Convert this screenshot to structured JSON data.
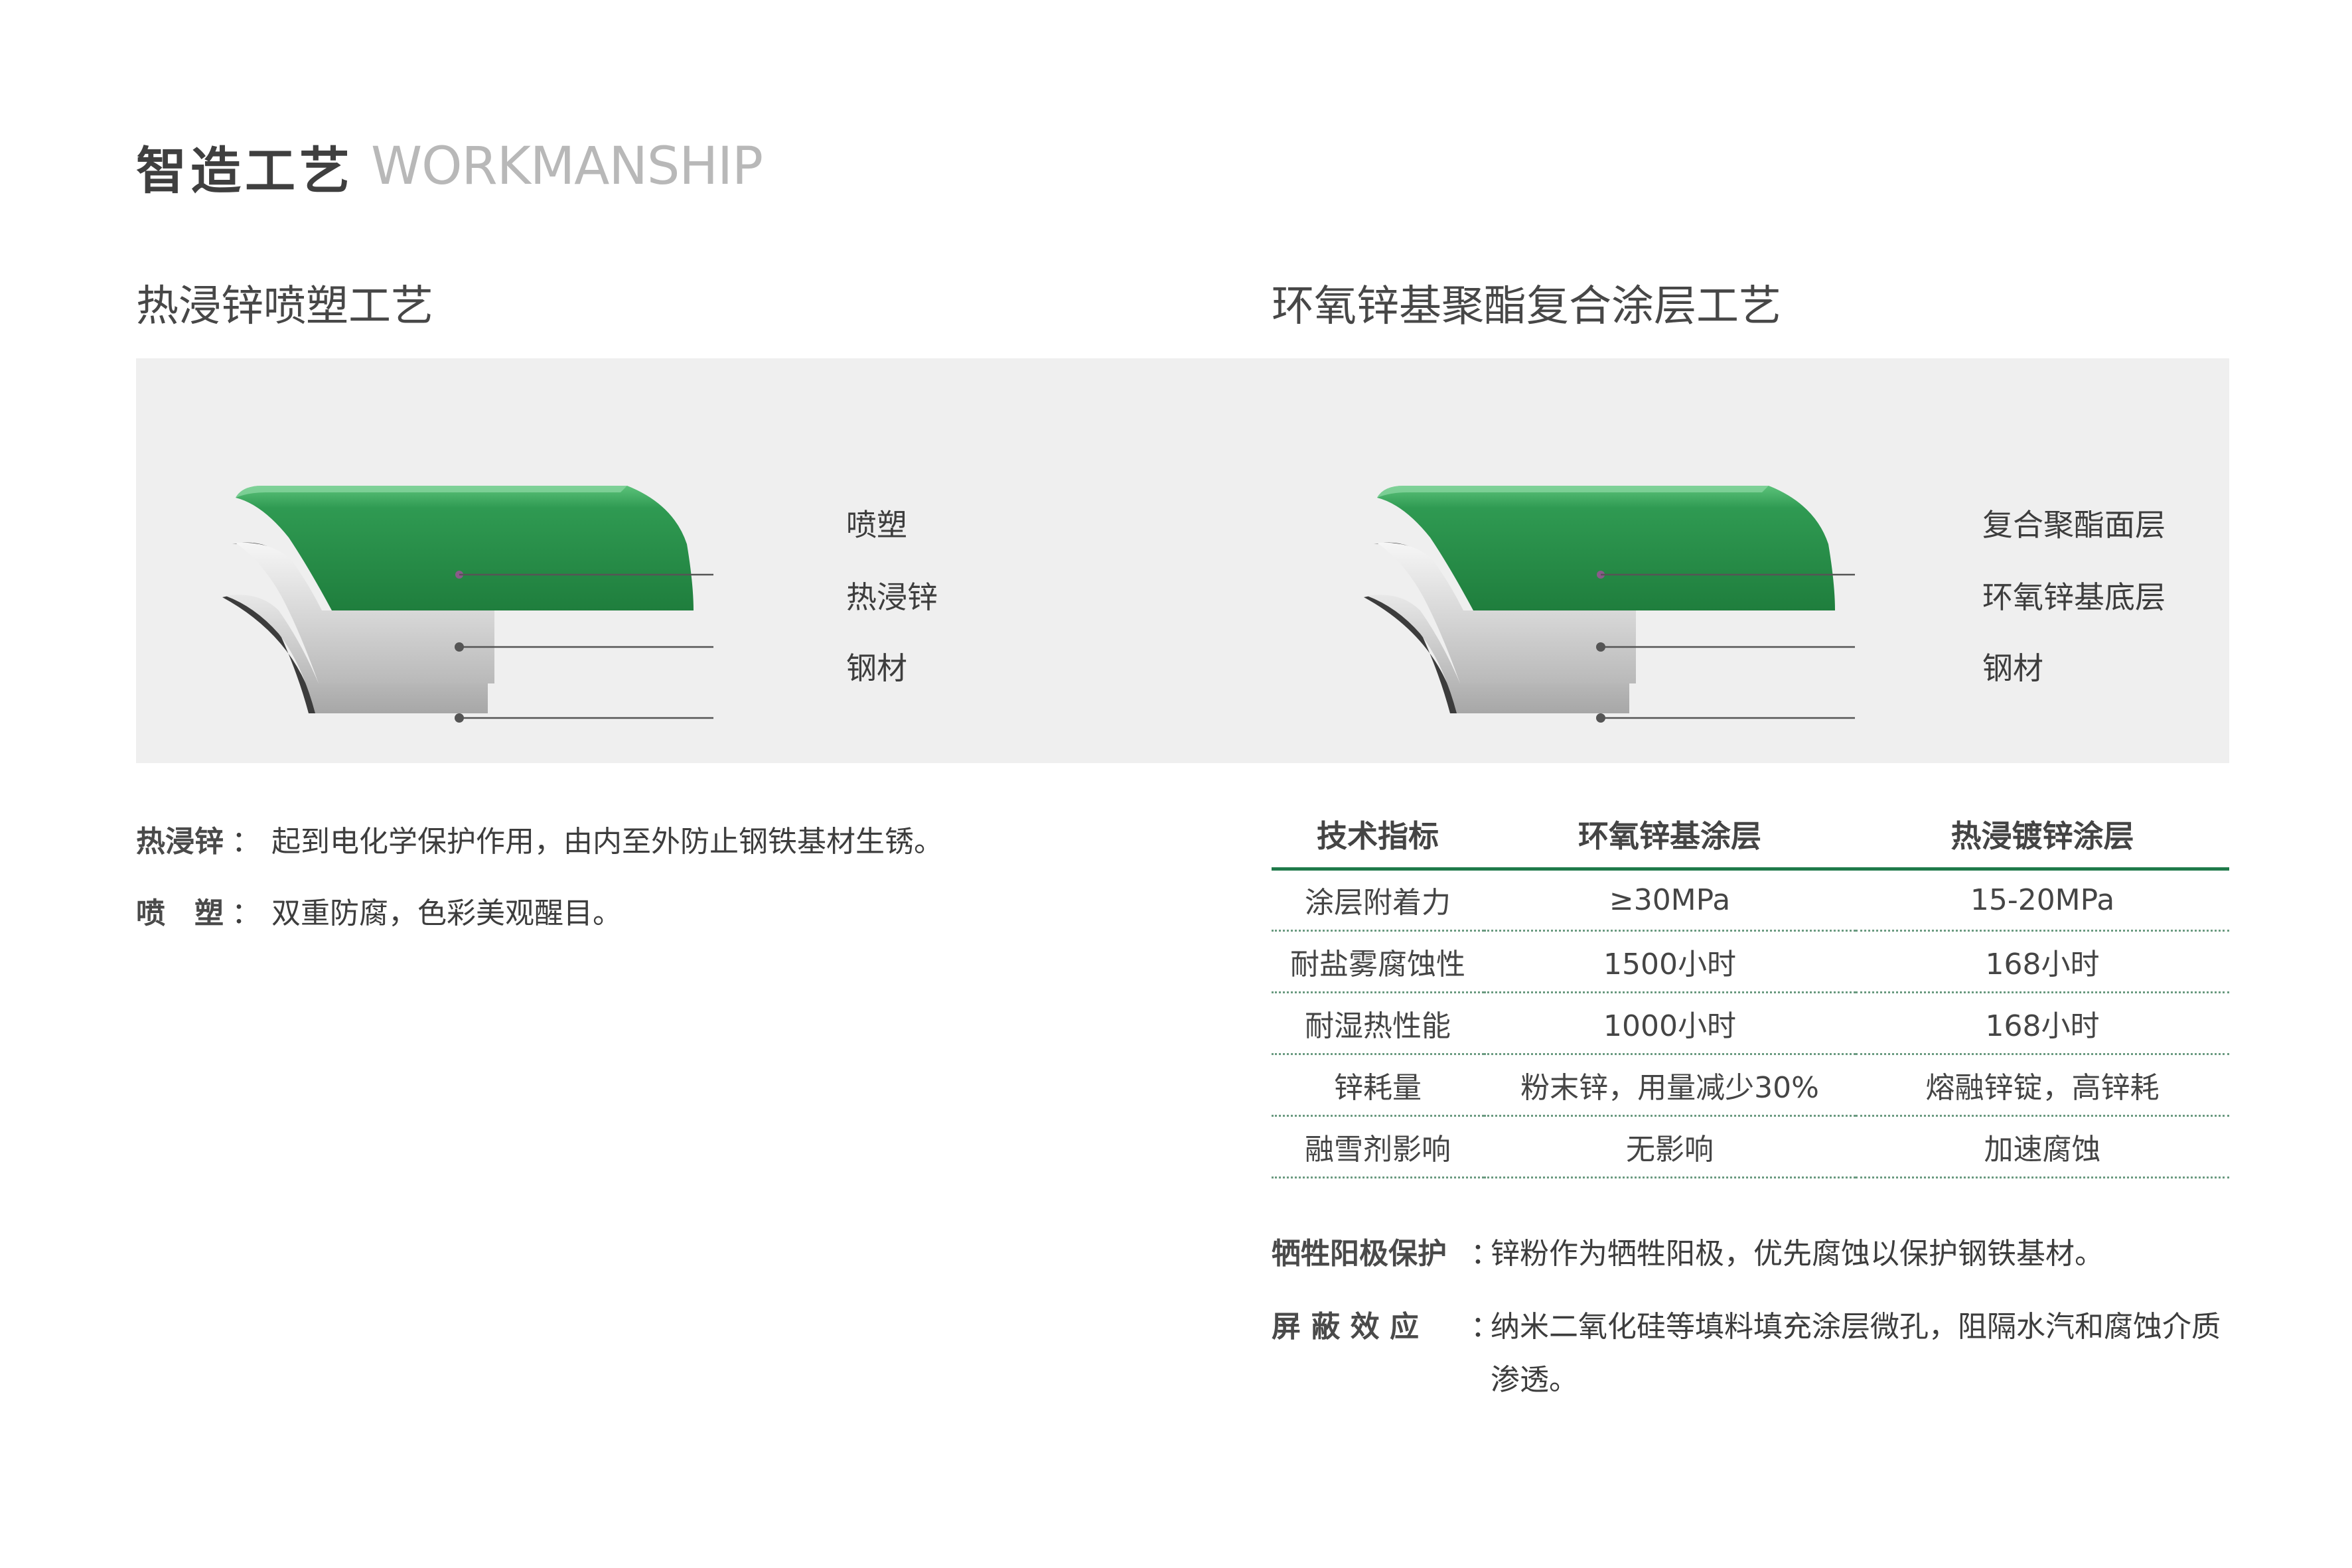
{
  "header": {
    "title_cn": "智造工艺",
    "title_en": "WORKMANSHIP"
  },
  "sections": {
    "left_title": "热浸锌喷塑工艺",
    "right_title": "环氧锌基聚酯复合涂层工艺"
  },
  "illustrations": {
    "left": {
      "labels": [
        "喷塑",
        "热浸锌",
        "钢材"
      ]
    },
    "right": {
      "labels": [
        "复合聚酯面层",
        "环氧锌基底层",
        "钢材"
      ]
    }
  },
  "descriptions": [
    {
      "term": "热浸锌",
      "colon": "：",
      "text": "起到电化学保护作用，由内至外防止钢铁基材生锈。"
    },
    {
      "term": "喷　塑",
      "colon": "：",
      "text": "双重防腐，色彩美观醒目。"
    }
  ],
  "spec_table": {
    "headers": [
      "技术指标",
      "环氧锌基涂层",
      "热浸镀锌涂层"
    ],
    "rows": [
      [
        "涂层附着力",
        "≥30MPa",
        "15-20MPa"
      ],
      [
        "耐盐雾腐蚀性",
        "1500小时",
        "168小时"
      ],
      [
        "耐湿热性能",
        "1000小时",
        "168小时"
      ],
      [
        "锌耗量",
        "粉末锌，用量减少30%",
        "熔融锌锭，高锌耗"
      ],
      [
        "融雪剂影响",
        "无影响",
        "加速腐蚀"
      ]
    ]
  },
  "notes": [
    {
      "term": "牺牲阳极保护",
      "colon": "：",
      "text": "锌粉作为牺牲阳极，优先腐蚀以保护钢铁基材。"
    },
    {
      "term": "屏 蔽 效 应",
      "colon": "：",
      "text": "纳米二氧化硅等填料填充涂层微孔，阻隔水汽和腐蚀介质渗透。"
    }
  ],
  "colors": {
    "accent_green": "#1f7a4a",
    "coating_green": "#27924a",
    "panel_bg": "#efefef"
  }
}
